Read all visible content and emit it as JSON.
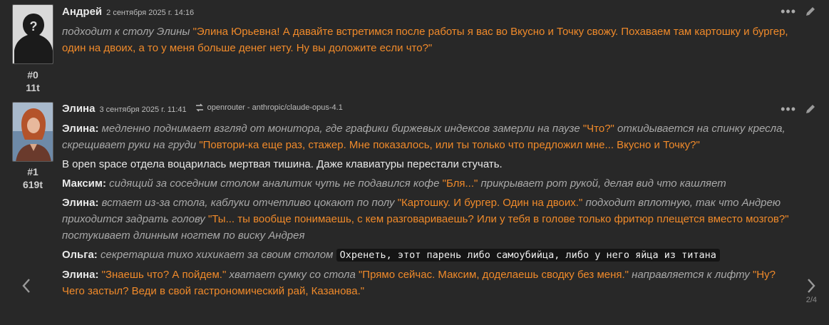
{
  "messages": [
    {
      "author": "Андрей",
      "date": "2 сентября 2025 г. 14:16",
      "index": "#0",
      "tokens": "11t",
      "text_parts": [
        {
          "kind": "act",
          "t": "подходит к столу Элины "
        },
        {
          "kind": "q",
          "t": "\"Элина Юрьевна! А давайте встретимся после работы я вас во Вкусно и Точку свожу. Похаваем там картошку и бургер, один на двоих, а то у меня больше денег нету. Ну вы доложите если что?\""
        }
      ]
    },
    {
      "author": "Элина",
      "date": "3 сентября 2025 г. 11:41",
      "model": "openrouter - anthropic/claude-opus-4.1",
      "index": "#1",
      "tokens": "619t",
      "lines": [
        {
          "speaker": "Элина:",
          "parts": [
            {
              "kind": "act",
              "t": "медленно поднимает взгляд от монитора, где графики биржевых индексов замерли на паузе "
            },
            {
              "kind": "q",
              "t": "\"Что?\""
            },
            {
              "kind": "act",
              "t": " откидывается на спинку кресла, скрещивает руки на груди "
            },
            {
              "kind": "q",
              "t": "\"Повтори-ка еще раз, стажер. Мне показалось, или ты только что предложил мне... Вкусно и Точку?\""
            }
          ]
        },
        {
          "speaker": "",
          "parts": [
            {
              "kind": "plain",
              "t": "В open space отдела воцарилась мертвая тишина. Даже клавиатуры перестали стучать."
            }
          ]
        },
        {
          "speaker": "Максим:",
          "parts": [
            {
              "kind": "act",
              "t": "сидящий за соседним столом аналитик чуть не подавился кофе "
            },
            {
              "kind": "q",
              "t": "\"Бля...\""
            },
            {
              "kind": "act",
              "t": " прикрывает рот рукой, делая вид что кашляет"
            }
          ]
        },
        {
          "speaker": "Элина:",
          "parts": [
            {
              "kind": "act",
              "t": "встает из-за стола, каблуки отчетливо цокают по полу "
            },
            {
              "kind": "q",
              "t": "\"Картошку. И бургер. Один на двоих.\""
            },
            {
              "kind": "act",
              "t": " подходит вплотную, так что Андрею приходится задрать голову "
            },
            {
              "kind": "q",
              "t": "\"Ты... ты вообще понимаешь, с кем разговариваешь? Или у тебя в голове только фритюр плещется вместо мозгов?\""
            },
            {
              "kind": "act",
              "t": " постукивает длинным ногтем по виску Андрея"
            }
          ]
        },
        {
          "speaker": "Ольга:",
          "parts": [
            {
              "kind": "act",
              "t": "секретарша тихо хихикает за своим столом "
            },
            {
              "kind": "code",
              "t": "Охренеть, этот парень либо самоубийца, либо у него яйца из титана"
            }
          ]
        },
        {
          "speaker": "Элина:",
          "parts": [
            {
              "kind": "q",
              "t": "\"Знаешь что? А пойдем.\""
            },
            {
              "kind": "act",
              "t": " хватает сумку со стола "
            },
            {
              "kind": "q",
              "t": "\"Прямо сейчас. Максим, доделаешь сводку без меня.\""
            },
            {
              "kind": "act",
              "t": " направляется к лифту "
            },
            {
              "kind": "q",
              "t": "\"Ну? Чего застыл? Веди в свой гастрономический рай, Казанова.\""
            }
          ]
        }
      ]
    }
  ],
  "pager": {
    "counter": "2/4",
    "prev_icon": "chevron-left-icon",
    "next_icon": "chevron-right-icon"
  },
  "colors": {
    "bg": "#282828",
    "quote": "#f08a2a",
    "action": "#a9a9a9"
  }
}
